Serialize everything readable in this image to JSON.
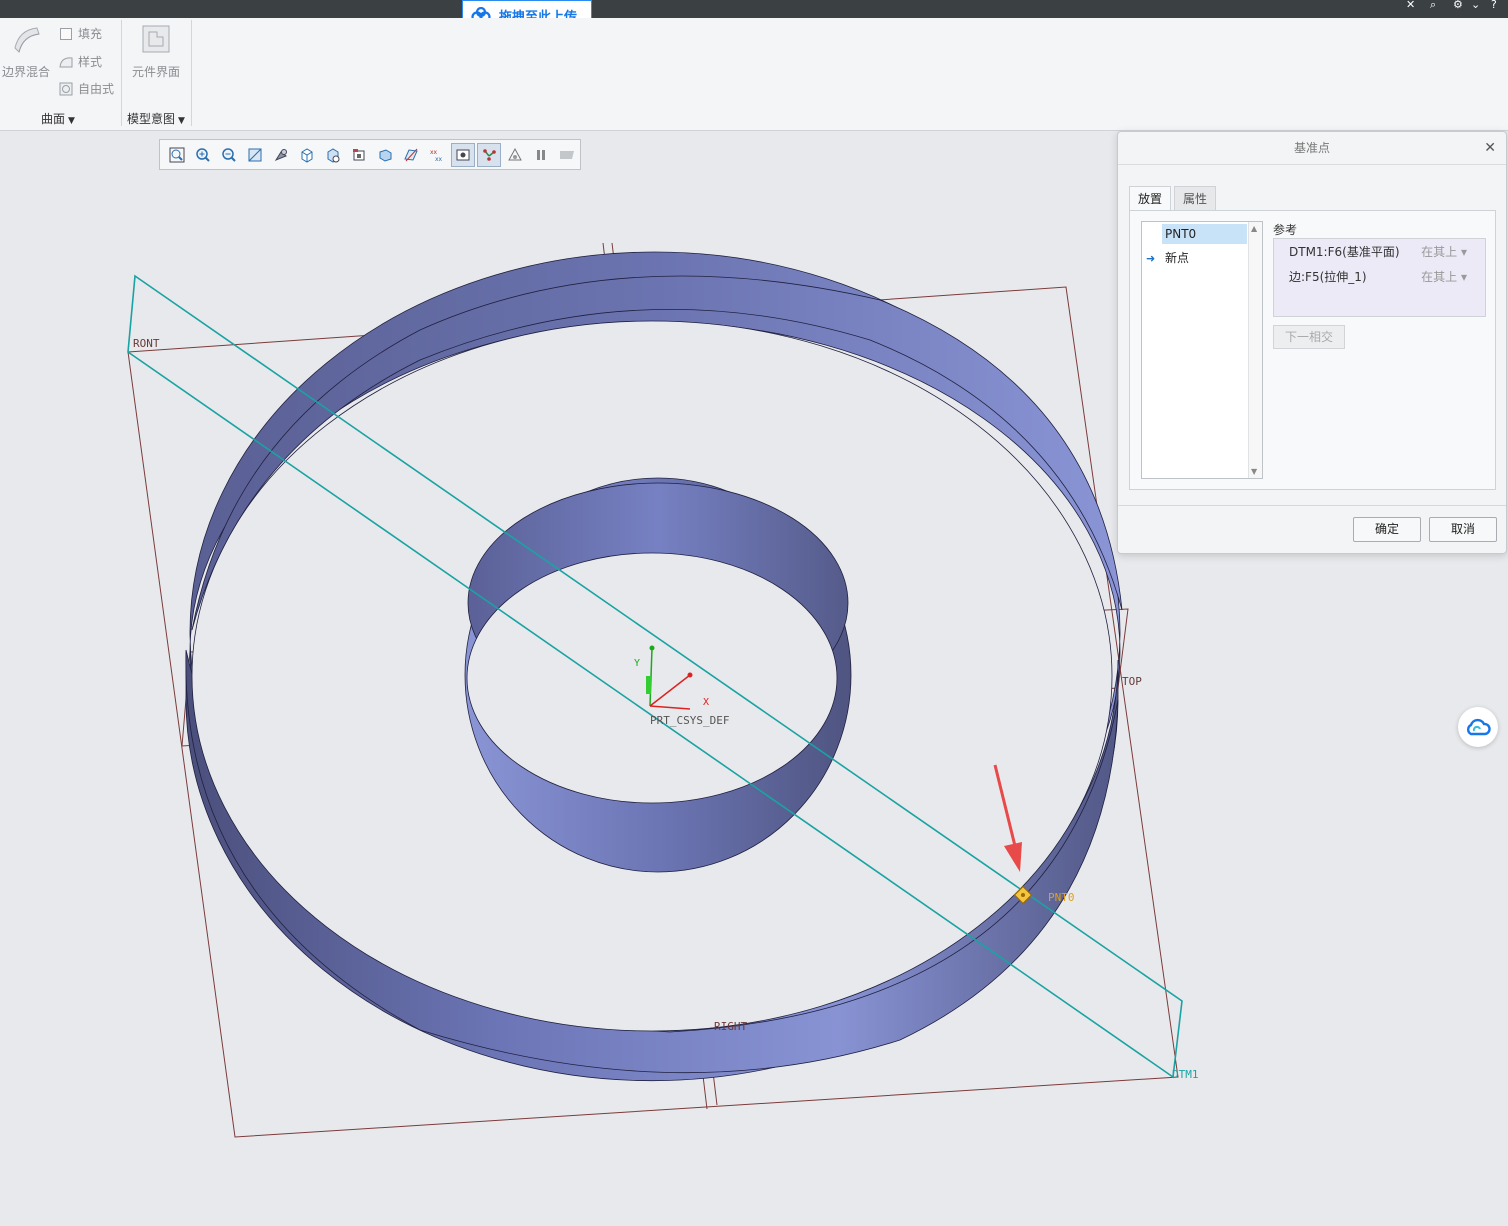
{
  "topbar": {
    "upload_label": "拖拽至此上传",
    "icons": [
      "x-icon",
      "pin-icon",
      "settings-icon",
      "chevron-down-icon",
      "help-icon"
    ]
  },
  "ribbon": {
    "surface_group": {
      "boundary_blend": "边界混合",
      "fill": "填充",
      "style": "样式",
      "freestyle": "自由式",
      "label": "曲面"
    },
    "intent_group": {
      "component_interface": "元件界面",
      "label": "模型意图"
    }
  },
  "graphics_toolbar": {
    "buttons": [
      "refit-icon",
      "zoom-in-icon",
      "zoom-out-icon",
      "repaint-icon",
      "display-style-icon",
      "saved-orientations-icon",
      "view-manager-icon",
      "perspective-icon",
      "spin-center-icon",
      "plane-display-icon",
      "point-display-icon",
      "csys-display-icon",
      "datum-display-icon",
      "annotation-display-icon",
      "pause-icon",
      "disabled-tool-icon"
    ]
  },
  "model": {
    "labels": {
      "front": "RONT",
      "top": "TOP",
      "right": "RIGHT",
      "dtm1": "DTM1",
      "pnt0": "PNT0",
      "csys": "PRT_CSYS_DEF",
      "axis_x": "X",
      "axis_y": "Y"
    },
    "colors": {
      "solid": "#7f89c8",
      "datum_plane": "#7b3b3b",
      "dtm_plane": "#1aa3a3",
      "point": "#e0a020",
      "annotation_arrow": "#e84a4a"
    }
  },
  "dialog": {
    "title": "基准点",
    "tabs": {
      "placement": "放置",
      "properties": "属性"
    },
    "points": [
      "PNT0",
      "新点"
    ],
    "references_label": "参考",
    "references": [
      {
        "ref": "DTM1:F6(基准平面)",
        "type": "在其上"
      },
      {
        "ref": "边:F5(拉伸_1)",
        "type": "在其上"
      }
    ],
    "next_intersection": "下一相交",
    "ok": "确定",
    "cancel": "取消"
  }
}
